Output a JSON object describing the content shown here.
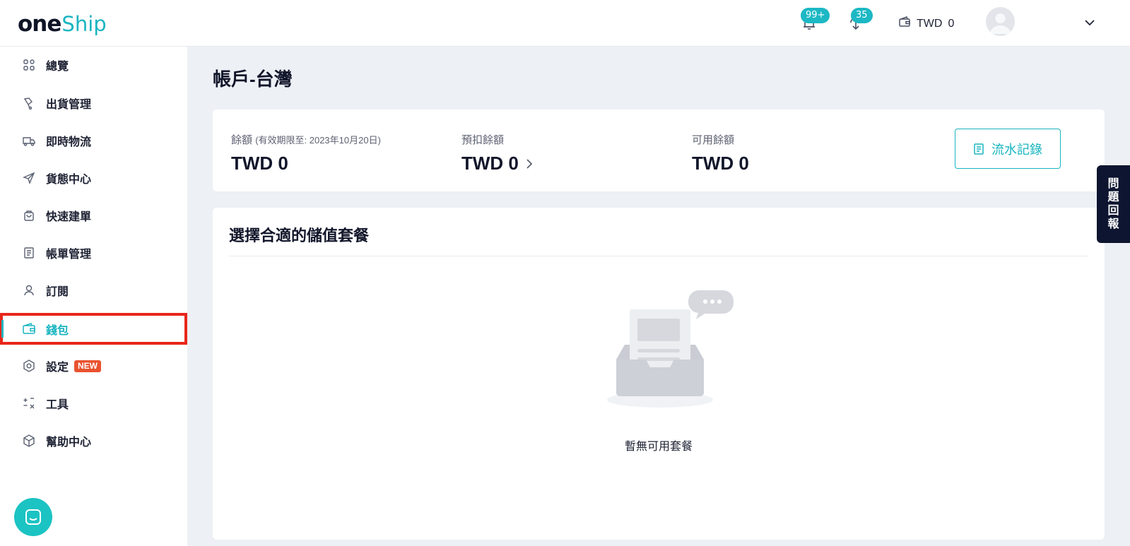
{
  "header": {
    "logo_one": "one",
    "logo_ship": "Ship",
    "notifications_badge": "99+",
    "downloads_badge": "35",
    "wallet_currency": "TWD",
    "wallet_amount": "0"
  },
  "sidebar": {
    "items": [
      {
        "label": "總覽",
        "icon": "dashboard-icon"
      },
      {
        "label": "出貨管理",
        "icon": "shipment-icon"
      },
      {
        "label": "即時物流",
        "icon": "realtime-logistics-icon"
      },
      {
        "label": "貨態中心",
        "icon": "send-icon"
      },
      {
        "label": "快速建單",
        "icon": "bag-icon"
      },
      {
        "label": "帳單管理",
        "icon": "bill-icon"
      },
      {
        "label": "訂閱",
        "icon": "user-icon"
      },
      {
        "label": "錢包",
        "icon": "wallet-icon"
      },
      {
        "label": "設定",
        "icon": "settings-icon",
        "tag": "NEW"
      },
      {
        "label": "工具",
        "icon": "tools-icon"
      },
      {
        "label": "幫助中心",
        "icon": "help-box-icon"
      }
    ]
  },
  "main": {
    "page_title": "帳戶-台灣",
    "balance": {
      "label": "餘額",
      "validity": "(有效期限至: 2023年10月20日)",
      "value": "TWD 0"
    },
    "pre_deduct": {
      "label": "預扣餘額",
      "value": "TWD 0"
    },
    "available": {
      "label": "可用餘額",
      "value": "TWD 0"
    },
    "history_button": "流水記錄",
    "plans": {
      "title": "選擇合適的儲值套餐",
      "empty_text": "暫無可用套餐"
    }
  },
  "feedback_tab": [
    "問",
    "題",
    "回",
    "報"
  ],
  "colors": {
    "accent": "#19b5c0",
    "highlight_border": "#e8261a",
    "new_tag": "#e9522f",
    "feedback_bg": "#0d1530"
  }
}
